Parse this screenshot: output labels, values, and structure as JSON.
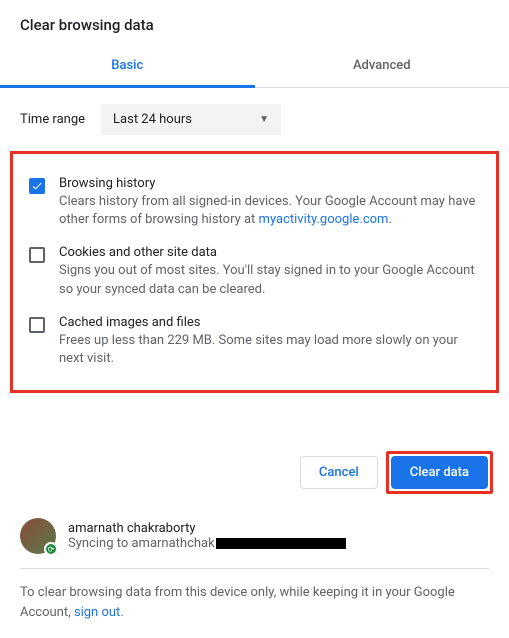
{
  "title": "Clear browsing data",
  "tabs": {
    "basic": "Basic",
    "advanced": "Advanced"
  },
  "timeRange": {
    "label": "Time range",
    "value": "Last 24 hours"
  },
  "options": [
    {
      "checked": true,
      "title": "Browsing history",
      "desc1": "Clears history from all signed-in devices. Your Google Account may have other forms of browsing history at ",
      "link": "myactivity.google.com",
      "desc2": "."
    },
    {
      "checked": false,
      "title": "Cookies and other site data",
      "desc1": "Signs you out of most sites. You'll stay signed in to your Google Account so your synced data can be cleared."
    },
    {
      "checked": false,
      "title": "Cached images and files",
      "desc1": "Frees up less than 229 MB. Some sites may load more slowly on your next visit."
    }
  ],
  "buttons": {
    "cancel": "Cancel",
    "clear": "Clear data"
  },
  "account": {
    "name": "amarnath chakraborty",
    "syncPrefix": "Syncing to amarnathchak"
  },
  "footer": {
    "text1": "To clear browsing data from this device only, while keeping it in your Google Account, ",
    "link": "sign out",
    "text2": "."
  }
}
